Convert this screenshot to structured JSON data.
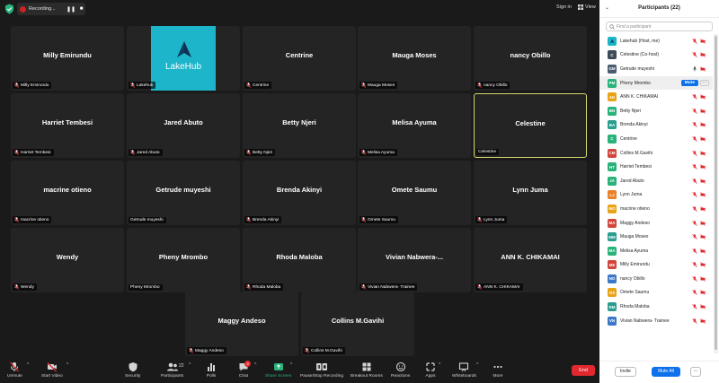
{
  "top_bar": {
    "recording_label": "Recording...",
    "pause_glyph": "❚❚",
    "stop_glyph": "■",
    "sign_in": "Sign in",
    "view": "View"
  },
  "tiles": [
    {
      "name": "Milly Emirundu",
      "label": "Milly Emirundu",
      "muted": true
    },
    {
      "name": "",
      "label": "Lakehub",
      "muted": true,
      "logo": "LakeHub"
    },
    {
      "name": "Centrine",
      "label": "Centrine",
      "muted": true
    },
    {
      "name": "Mauga Moses",
      "label": "Mauga Moses",
      "muted": true
    },
    {
      "name": "nancy Obillo",
      "label": "nancy Obillo",
      "muted": true
    },
    {
      "name": "Harriet Tembesi",
      "label": "Harriet Tembesi",
      "muted": true
    },
    {
      "name": "Jared Abuto",
      "label": "Jared Abuto",
      "muted": true
    },
    {
      "name": "Betty Njeri",
      "label": "Betty Njeri",
      "muted": true
    },
    {
      "name": "Melisa Ayuma",
      "label": "Melisa Ayuma",
      "muted": true
    },
    {
      "name": "Celestine",
      "label": "Celestine",
      "muted": false,
      "active": true
    },
    {
      "name": "macrine otieno",
      "label": "macrine otieno",
      "muted": true
    },
    {
      "name": "Getrude muyeshi",
      "label": "Getrude muyeshi",
      "muted": false
    },
    {
      "name": "Brenda Akinyi",
      "label": "Brenda Akinyi",
      "muted": true
    },
    {
      "name": "Omete Saumu",
      "label": "Omete Saumu",
      "muted": true
    },
    {
      "name": "Lynn Juma",
      "label": "Lynn Juma",
      "muted": true
    },
    {
      "name": "Wendy",
      "label": "Wendy",
      "muted": true
    },
    {
      "name": "Pheny Mrombo",
      "label": "Pheny Mrombo",
      "muted": false
    },
    {
      "name": "Rhoda Maloba",
      "label": "Rhoda Maloba",
      "muted": true
    },
    {
      "name": "Vivian  Nabwera-...",
      "label": "Vivian Nabwera- Trainee",
      "muted": true
    },
    {
      "name": "ANN K. CHIKAMAI",
      "label": "ANN K. CHIKAMAI",
      "muted": true
    },
    {
      "name": "Maggy Andeso",
      "label": "Maggy Andeso",
      "muted": true
    },
    {
      "name": "Collins M.Gavihi",
      "label": "Collins M.Gavihi",
      "muted": true
    }
  ],
  "toolbar": {
    "unmute": "Unmute",
    "start_video": "Start Video",
    "security": "Security",
    "participants": "Participants",
    "participants_count": "22",
    "polls": "Polls",
    "chat": "Chat",
    "chat_badge": "3",
    "share_screen": "Share Screen",
    "pause_stop_recording": "Pause/Stop Recording",
    "breakout_rooms": "Breakout Rooms",
    "reactions": "Reactions",
    "apps": "Apps",
    "whiteboards": "Whiteboards",
    "more": "More",
    "end": "End"
  },
  "panel": {
    "title": "Participants (22)",
    "search_placeholder": "Find a participant",
    "mute_label": "Mute",
    "more_label": "···",
    "invite": "Invite",
    "mute_all": "Mute All",
    "footer_more": "...",
    "participants": [
      {
        "initials": "",
        "name": "Lakehub (Host, me)",
        "color": "#1cb5c9",
        "logo": true,
        "mic": "muted",
        "video": "off"
      },
      {
        "initials": "C",
        "name": "Celestine (Co-host)",
        "color": "#3d4a57",
        "mic": "muted",
        "video": "off"
      },
      {
        "initials": "GM",
        "name": "Getrude muyeshi",
        "color": "#4a5a70",
        "mic": "on",
        "video": "off"
      },
      {
        "initials": "PM",
        "name": "Pheny Mrombo",
        "color": "#2ab27b",
        "mic": "on",
        "video": "off",
        "highlight": true
      },
      {
        "initials": "AK",
        "name": "ANN K. CHIKAMAI",
        "color": "#e8a317",
        "mic": "muted",
        "video": "off"
      },
      {
        "initials": "BN",
        "name": "Betty Njeri",
        "color": "#2ab27b",
        "mic": "muted",
        "video": "off"
      },
      {
        "initials": "BA",
        "name": "Brenda Akinyi",
        "color": "#2a9d8f",
        "mic": "muted",
        "video": "off"
      },
      {
        "initials": "C",
        "name": "Centrine",
        "color": "#2ab27b",
        "mic": "muted",
        "video": "off"
      },
      {
        "initials": "CM",
        "name": "Collins M.Gavihi",
        "color": "#d1453b",
        "mic": "muted",
        "video": "off"
      },
      {
        "initials": "HT",
        "name": "Harriet Tembesi",
        "color": "#2ab27b",
        "mic": "muted",
        "video": "off"
      },
      {
        "initials": "JA",
        "name": "Jared Abuto",
        "color": "#2ab27b",
        "mic": "muted",
        "video": "off"
      },
      {
        "initials": "LJ",
        "name": "Lynn Juma",
        "color": "#e8812a",
        "mic": "muted",
        "video": "off"
      },
      {
        "initials": "MO",
        "name": "macrine otieno",
        "color": "#e8a317",
        "mic": "muted",
        "video": "off"
      },
      {
        "initials": "MA",
        "name": "Maggy Andeso",
        "color": "#d1453b",
        "mic": "muted",
        "video": "off"
      },
      {
        "initials": "MM",
        "name": "Mauga Moses",
        "color": "#2a9d8f",
        "mic": "muted",
        "video": "off"
      },
      {
        "initials": "MA",
        "name": "Melisa Ayuma",
        "color": "#2ab27b",
        "mic": "muted",
        "video": "off"
      },
      {
        "initials": "ME",
        "name": "Milly Emirundu",
        "color": "#d1453b",
        "mic": "muted",
        "video": "off"
      },
      {
        "initials": "NO",
        "name": "nancy Obillo",
        "color": "#3c78c8",
        "mic": "muted",
        "video": "off"
      },
      {
        "initials": "OS",
        "name": "Omete Saumu",
        "color": "#e8a317",
        "mic": "muted",
        "video": "off"
      },
      {
        "initials": "RM",
        "name": "Rhoda Maloba",
        "color": "#2a9d8f",
        "mic": "muted",
        "video": "off"
      },
      {
        "initials": "VN",
        "name": "Vivian Nabwera- Trainee",
        "color": "#3c78c8",
        "mic": "muted",
        "video": "off"
      }
    ]
  },
  "colors": {
    "accent_blue": "#0e71eb",
    "muted_red": "#e0282e",
    "active_border": "#d6d66a",
    "end_red": "#e0282e",
    "share_green": "#2ab27b"
  }
}
